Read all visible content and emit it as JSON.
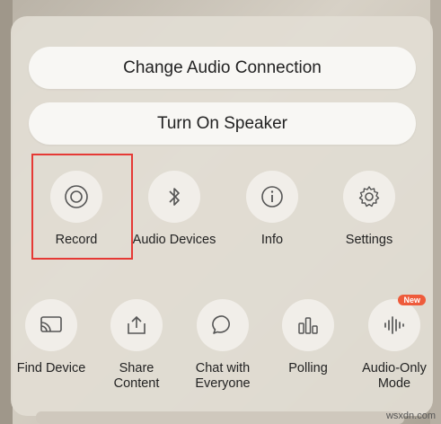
{
  "panel": {
    "pills": {
      "audio_connection": "Change Audio Connection",
      "speaker": "Turn On Speaker"
    },
    "row1": [
      {
        "label": "Record",
        "icon": "record-icon"
      },
      {
        "label": "Audio Devices",
        "icon": "bluetooth-icon"
      },
      {
        "label": "Info",
        "icon": "info-icon"
      },
      {
        "label": "Settings",
        "icon": "gear-icon"
      }
    ],
    "row2": [
      {
        "label": "Find Device",
        "icon": "cast-icon"
      },
      {
        "label": "Share\nContent",
        "icon": "share-icon"
      },
      {
        "label": "Chat with\nEveryone",
        "icon": "chat-bubble-icon"
      },
      {
        "label": "Polling",
        "icon": "polling-icon"
      },
      {
        "label": "Audio-Only\nMode",
        "icon": "audio-wave-icon",
        "badge": "New"
      }
    ],
    "highlight_color": "#e53935",
    "badge_color": "#ee5b3b"
  },
  "watermark": "wsxdn.com"
}
